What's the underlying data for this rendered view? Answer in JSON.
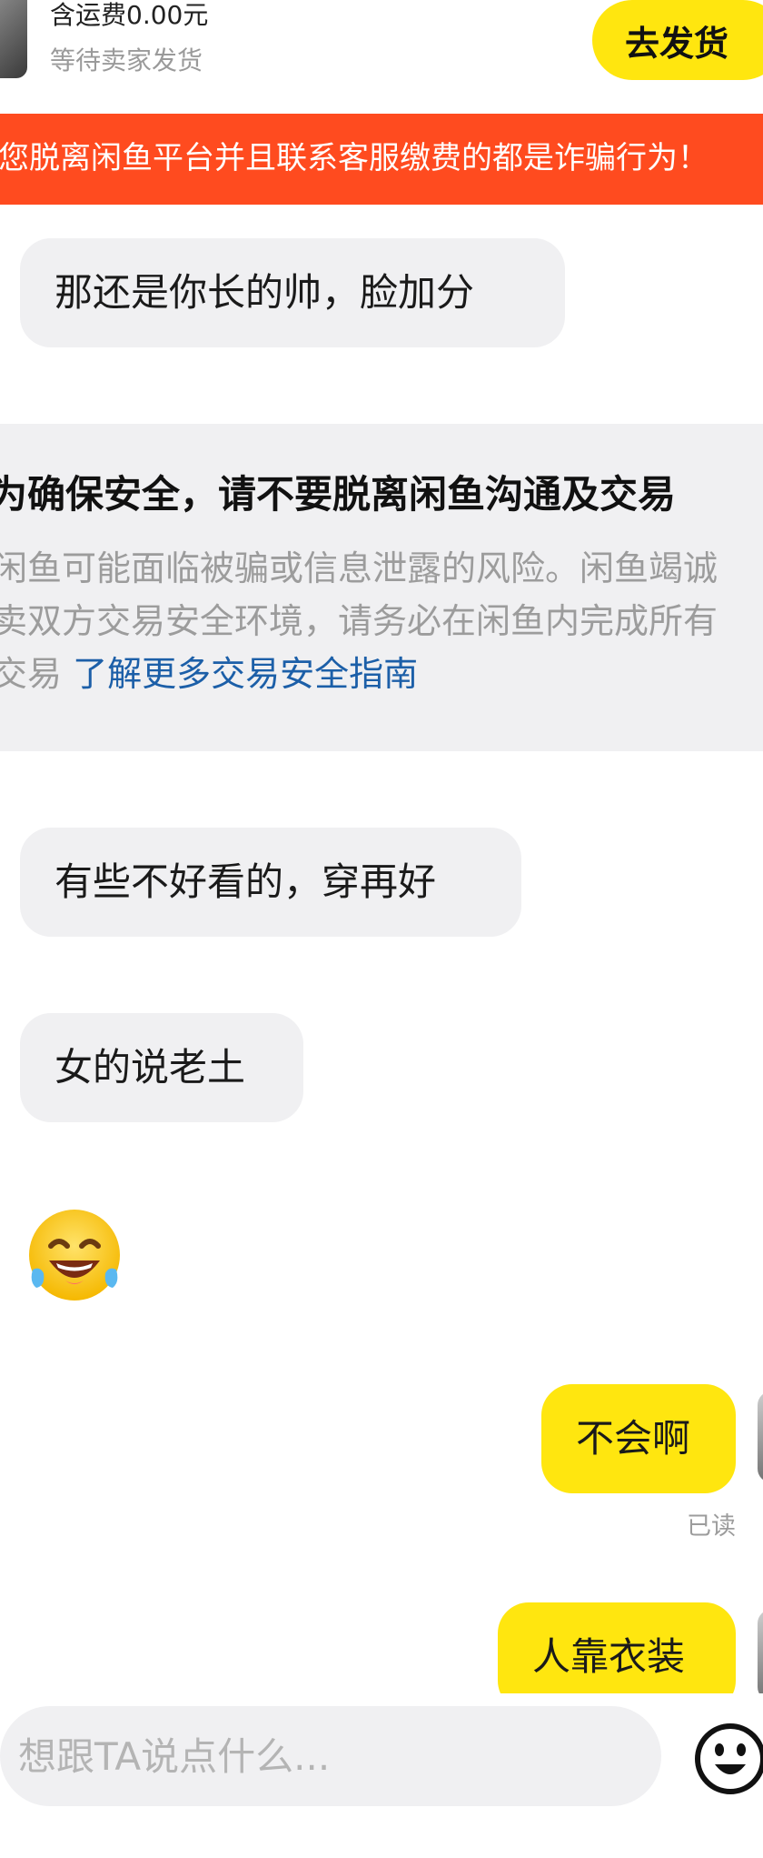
{
  "order": {
    "shipping_fee": "含运费0.00元",
    "status": "等待卖家发货",
    "ship_button": "去发货"
  },
  "fraud_banner": {
    "text": "您脱离闲鱼平台并且联系客服缴费的都是诈骗行为！"
  },
  "messages": [
    {
      "side": "incoming",
      "text": "那还是你长的帅，脸加分"
    },
    {
      "side": "incoming",
      "text": "有些不好看的，穿再好"
    },
    {
      "side": "incoming",
      "text": "女的说老土"
    },
    {
      "side": "incoming",
      "emoji": "tears-of-joy-emoji"
    },
    {
      "side": "outgoing",
      "text": "不会啊",
      "receipt": "已读"
    },
    {
      "side": "outgoing",
      "text": "人靠衣装"
    }
  ],
  "security_notice": {
    "title": "为确保安全，请不要脱离闲鱼沟通及交易",
    "body_lines": [
      "闲鱼可能面临被骗或信息泄露的风险。闲鱼竭诚",
      "卖双方交易安全环境，请务必在闲鱼内完成所有"
    ],
    "body_last": "交易",
    "link": "了解更多交易安全指南"
  },
  "composer": {
    "placeholder": "想跟TA说点什么...",
    "emoji_icon": "emoji-picker-icon"
  },
  "colors": {
    "accent_yellow": "#ffe60f",
    "warning_orange": "#ff4b1f",
    "bubble_gray": "#f0f0f2",
    "link_blue": "#1c5fa8"
  }
}
